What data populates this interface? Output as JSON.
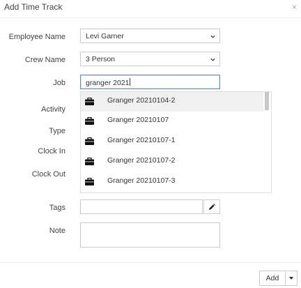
{
  "dialog": {
    "title": "Add Time Track",
    "close_glyph": "×"
  },
  "form": {
    "employee_label": "Employee Name",
    "employee_value": "Levi Garner",
    "crew_label": "Crew Name",
    "crew_value": "3 Person",
    "job_label": "Job",
    "job_input_value": "granger 2021",
    "activity_label": "Activity",
    "type_label": "Type",
    "clock_in_label": "Clock In",
    "clock_out_label": "Clock Out",
    "tags_label": "Tags",
    "tags_value": "",
    "note_label": "Note",
    "note_value": ""
  },
  "job_suggestions": [
    {
      "label": "Granger 20210104-2",
      "highlighted": true,
      "icon": "briefcase-icon"
    },
    {
      "label": "Granger 20210107",
      "highlighted": false,
      "icon": "briefcase-icon"
    },
    {
      "label": "Granger 20210107-1",
      "highlighted": false,
      "icon": "briefcase-icon"
    },
    {
      "label": "Granger 20210107-2",
      "highlighted": false,
      "icon": "briefcase-icon"
    },
    {
      "label": "Granger 20210107-3",
      "highlighted": false,
      "icon": "briefcase-icon"
    }
  ],
  "footer": {
    "add_label": "Add"
  },
  "colors": {
    "focus_border": "#6b8fb3",
    "highlight_row": "#f0f0f0",
    "border": "#cccccc"
  }
}
